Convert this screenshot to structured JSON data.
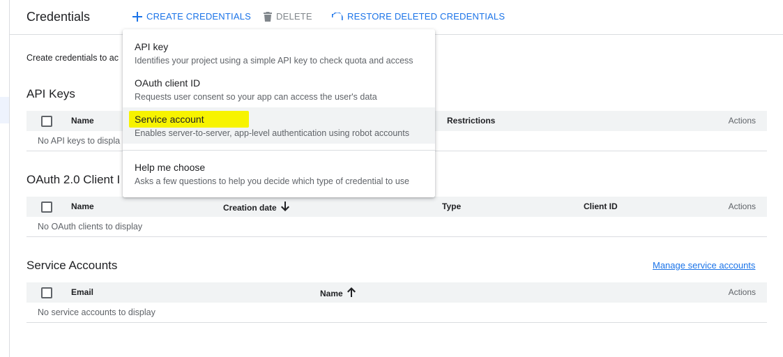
{
  "header": {
    "title": "Credentials",
    "create_label": "CREATE CREDENTIALS",
    "delete_label": "DELETE",
    "restore_label": "RESTORE DELETED CREDENTIALS",
    "accent_color": "#1a73e8"
  },
  "intro_text": "Create credentials to ac",
  "api_keys": {
    "title": "API Keys",
    "columns": {
      "name": "Name",
      "restrictions": "Restrictions",
      "actions": "Actions"
    },
    "empty": "No API keys to displa"
  },
  "oauth": {
    "title": "OAuth 2.0 Client I",
    "columns": {
      "name": "Name",
      "creation_date": "Creation date",
      "type": "Type",
      "client_id": "Client ID",
      "actions": "Actions"
    },
    "empty": "No OAuth clients to display"
  },
  "service_accounts": {
    "title": "Service Accounts",
    "manage_link": "Manage service accounts",
    "columns": {
      "email": "Email",
      "name": "Name",
      "actions": "Actions"
    },
    "empty": "No service accounts to display"
  },
  "menu": {
    "items": [
      {
        "title": "API key",
        "description": "Identifies your project using a simple API key to check quota and access"
      },
      {
        "title": "OAuth client ID",
        "description": "Requests user consent so your app can access the user's data"
      },
      {
        "title": "Service account",
        "description": "Enables server-to-server, app-level authentication using robot accounts"
      },
      {
        "title": "Help me choose",
        "description": "Asks a few questions to help you decide which type of credential to use"
      }
    ],
    "highlight_color": "#f7f300"
  },
  "icons": {
    "create": "plus-icon",
    "delete": "trash-icon",
    "restore": "undo-icon",
    "sort_desc": "arrow-down-icon",
    "sort_asc": "arrow-up-icon"
  }
}
